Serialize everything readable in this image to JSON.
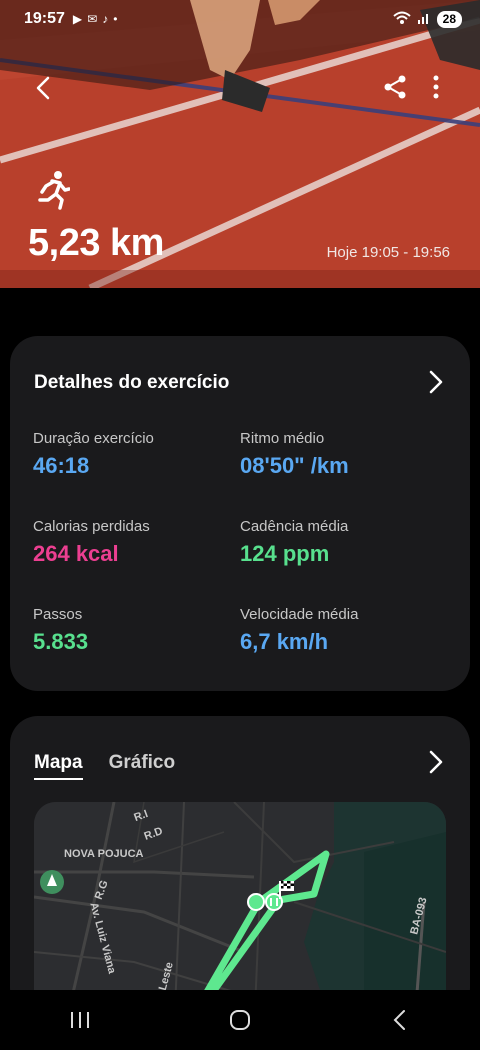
{
  "status_bar": {
    "time": "19:57",
    "battery": "28"
  },
  "hero": {
    "distance": "5,23 km",
    "time_range": "Hoje 19:05 - 19:56"
  },
  "details": {
    "title": "Detalhes do exercício",
    "stats": [
      {
        "label": "Duração exercício",
        "value": "46:18",
        "color": "#5aa8f2"
      },
      {
        "label": "Ritmo médio",
        "value": "08'50\" /km",
        "color": "#5aa8f2"
      },
      {
        "label": "Calorias perdidas",
        "value": "264 kcal",
        "color": "#ec3f91"
      },
      {
        "label": "Cadência média",
        "value": "124 ppm",
        "color": "#58e08e"
      },
      {
        "label": "Passos",
        "value": "5.833",
        "color": "#58e08e"
      },
      {
        "label": "Velocidade média",
        "value": "6,7 km/h",
        "color": "#5aa8f2"
      }
    ]
  },
  "map_card": {
    "tabs": [
      {
        "label": "Mapa",
        "active": true
      },
      {
        "label": "Gráfico",
        "active": false
      }
    ],
    "map_labels": {
      "ri": "R.I",
      "rd": "R.D",
      "nova_pojuca": "NOVA POJUCA",
      "rg": "R.G",
      "av_luiz_viana": "Av. Luiz Viana",
      "da_leste": "da Leste",
      "ba093": "BA-093"
    },
    "route_color": "#5ee88f"
  }
}
